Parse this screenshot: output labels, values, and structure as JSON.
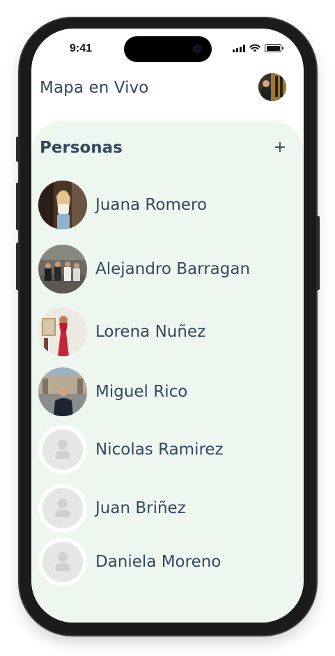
{
  "status_bar": {
    "time": "9:41"
  },
  "header": {
    "title": "Mapa en Vivo"
  },
  "people": {
    "title": "Personas",
    "add_label": "+",
    "contacts": [
      {
        "name": "Juana Romero",
        "has_photo": true
      },
      {
        "name": "Alejandro Barragan",
        "has_photo": true
      },
      {
        "name": "Lorena Nuñez",
        "has_photo": true
      },
      {
        "name": "Miguel Rico",
        "has_photo": true
      },
      {
        "name": "Nicolas Ramirez",
        "has_photo": false
      },
      {
        "name": "Juan Briñez",
        "has_photo": false
      },
      {
        "name": "Daniela Moreno",
        "has_photo": false
      }
    ]
  },
  "colors": {
    "text": "#34485e",
    "panel_background": "#eef6f0",
    "placeholder": "#e6e6e6"
  }
}
